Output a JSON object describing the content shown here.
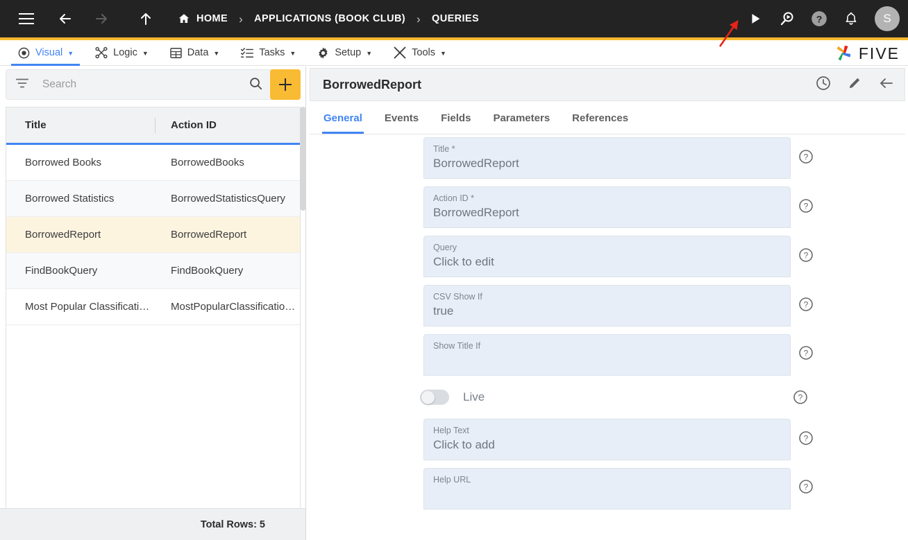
{
  "topbar": {
    "menu_icon": "hamburger-icon",
    "back_icon": "arrow-left-icon",
    "forward_icon": "arrow-right-icon",
    "up_icon": "arrow-up-icon",
    "breadcrumb": [
      {
        "label": "HOME",
        "icon": "home-icon"
      },
      {
        "label": "APPLICATIONS (BOOK CLUB)",
        "icon": ""
      },
      {
        "label": "QUERIES",
        "icon": ""
      }
    ],
    "separator": "›",
    "actions": [
      {
        "name": "run-button",
        "icon": "play-icon"
      },
      {
        "name": "search-run-button",
        "icon": "search-play-icon"
      },
      {
        "name": "help-button",
        "icon": "question-circle-icon"
      },
      {
        "name": "notifications-button",
        "icon": "bell-icon"
      }
    ],
    "avatar_initial": "S",
    "accent_color": "#F9B82E",
    "bar_color": "#232323"
  },
  "menubar": {
    "items": [
      {
        "label": "Visual",
        "icon": "eye-icon",
        "active": true
      },
      {
        "label": "Logic",
        "icon": "logic-nodes-icon",
        "active": false
      },
      {
        "label": "Data",
        "icon": "table-grid-icon",
        "active": false
      },
      {
        "label": "Tasks",
        "icon": "checklist-icon",
        "active": false
      },
      {
        "label": "Setup",
        "icon": "gear-icon",
        "active": false
      },
      {
        "label": "Tools",
        "icon": "tools-icon",
        "active": false
      }
    ],
    "caret": "▼",
    "active_color": "#4285F4",
    "logo_text": "FIVE"
  },
  "sidebar": {
    "search": {
      "placeholder": "Search",
      "value": ""
    },
    "filter_icon": "filter-icon",
    "search_icon": "search-icon",
    "add_label": "+",
    "add_color": "#F9BB33",
    "columns": [
      "Title",
      "Action ID"
    ],
    "rows": [
      {
        "title": "Borrowed Books",
        "action_id": "BorrowedBooks",
        "selected": false
      },
      {
        "title": "Borrowed Statistics",
        "action_id": "BorrowedStatisticsQuery",
        "selected": false
      },
      {
        "title": "BorrowedReport",
        "action_id": "BorrowedReport",
        "selected": true
      },
      {
        "title": "FindBookQuery",
        "action_id": "FindBookQuery",
        "selected": false
      },
      {
        "title": "Most Popular Classificatio…",
        "action_id": "MostPopularClassification…",
        "selected": false
      }
    ],
    "total_rows_label": "Total Rows: 5"
  },
  "detail": {
    "title": "BorrowedReport",
    "head_icons": [
      {
        "name": "history-clock-icon"
      },
      {
        "name": "edit-pencil-icon"
      },
      {
        "name": "back-arrow-icon"
      }
    ],
    "tabs": [
      {
        "label": "General",
        "active": true
      },
      {
        "label": "Events",
        "active": false
      },
      {
        "label": "Fields",
        "active": false
      },
      {
        "label": "Parameters",
        "active": false
      },
      {
        "label": "References",
        "active": false
      }
    ],
    "fields": [
      {
        "label": "Title *",
        "value": "BorrowedReport",
        "tall": false
      },
      {
        "label": "Action ID *",
        "value": "BorrowedReport",
        "tall": false
      },
      {
        "label": "Query",
        "value": "Click to edit",
        "tall": false
      },
      {
        "label": "CSV Show If",
        "value": "true",
        "tall": false
      },
      {
        "label": "Show Title If",
        "value": "",
        "tall": true
      }
    ],
    "toggle": {
      "label": "Live",
      "on": false
    },
    "fields_after_toggle": [
      {
        "label": "Help Text",
        "value": "Click to add",
        "tall": false
      },
      {
        "label": "Help URL",
        "value": "",
        "tall": true
      }
    ],
    "help_icon": "question-circle-icon"
  },
  "annotation": {
    "type": "arrow",
    "color": "#E8231B",
    "points_to": "run-button"
  }
}
